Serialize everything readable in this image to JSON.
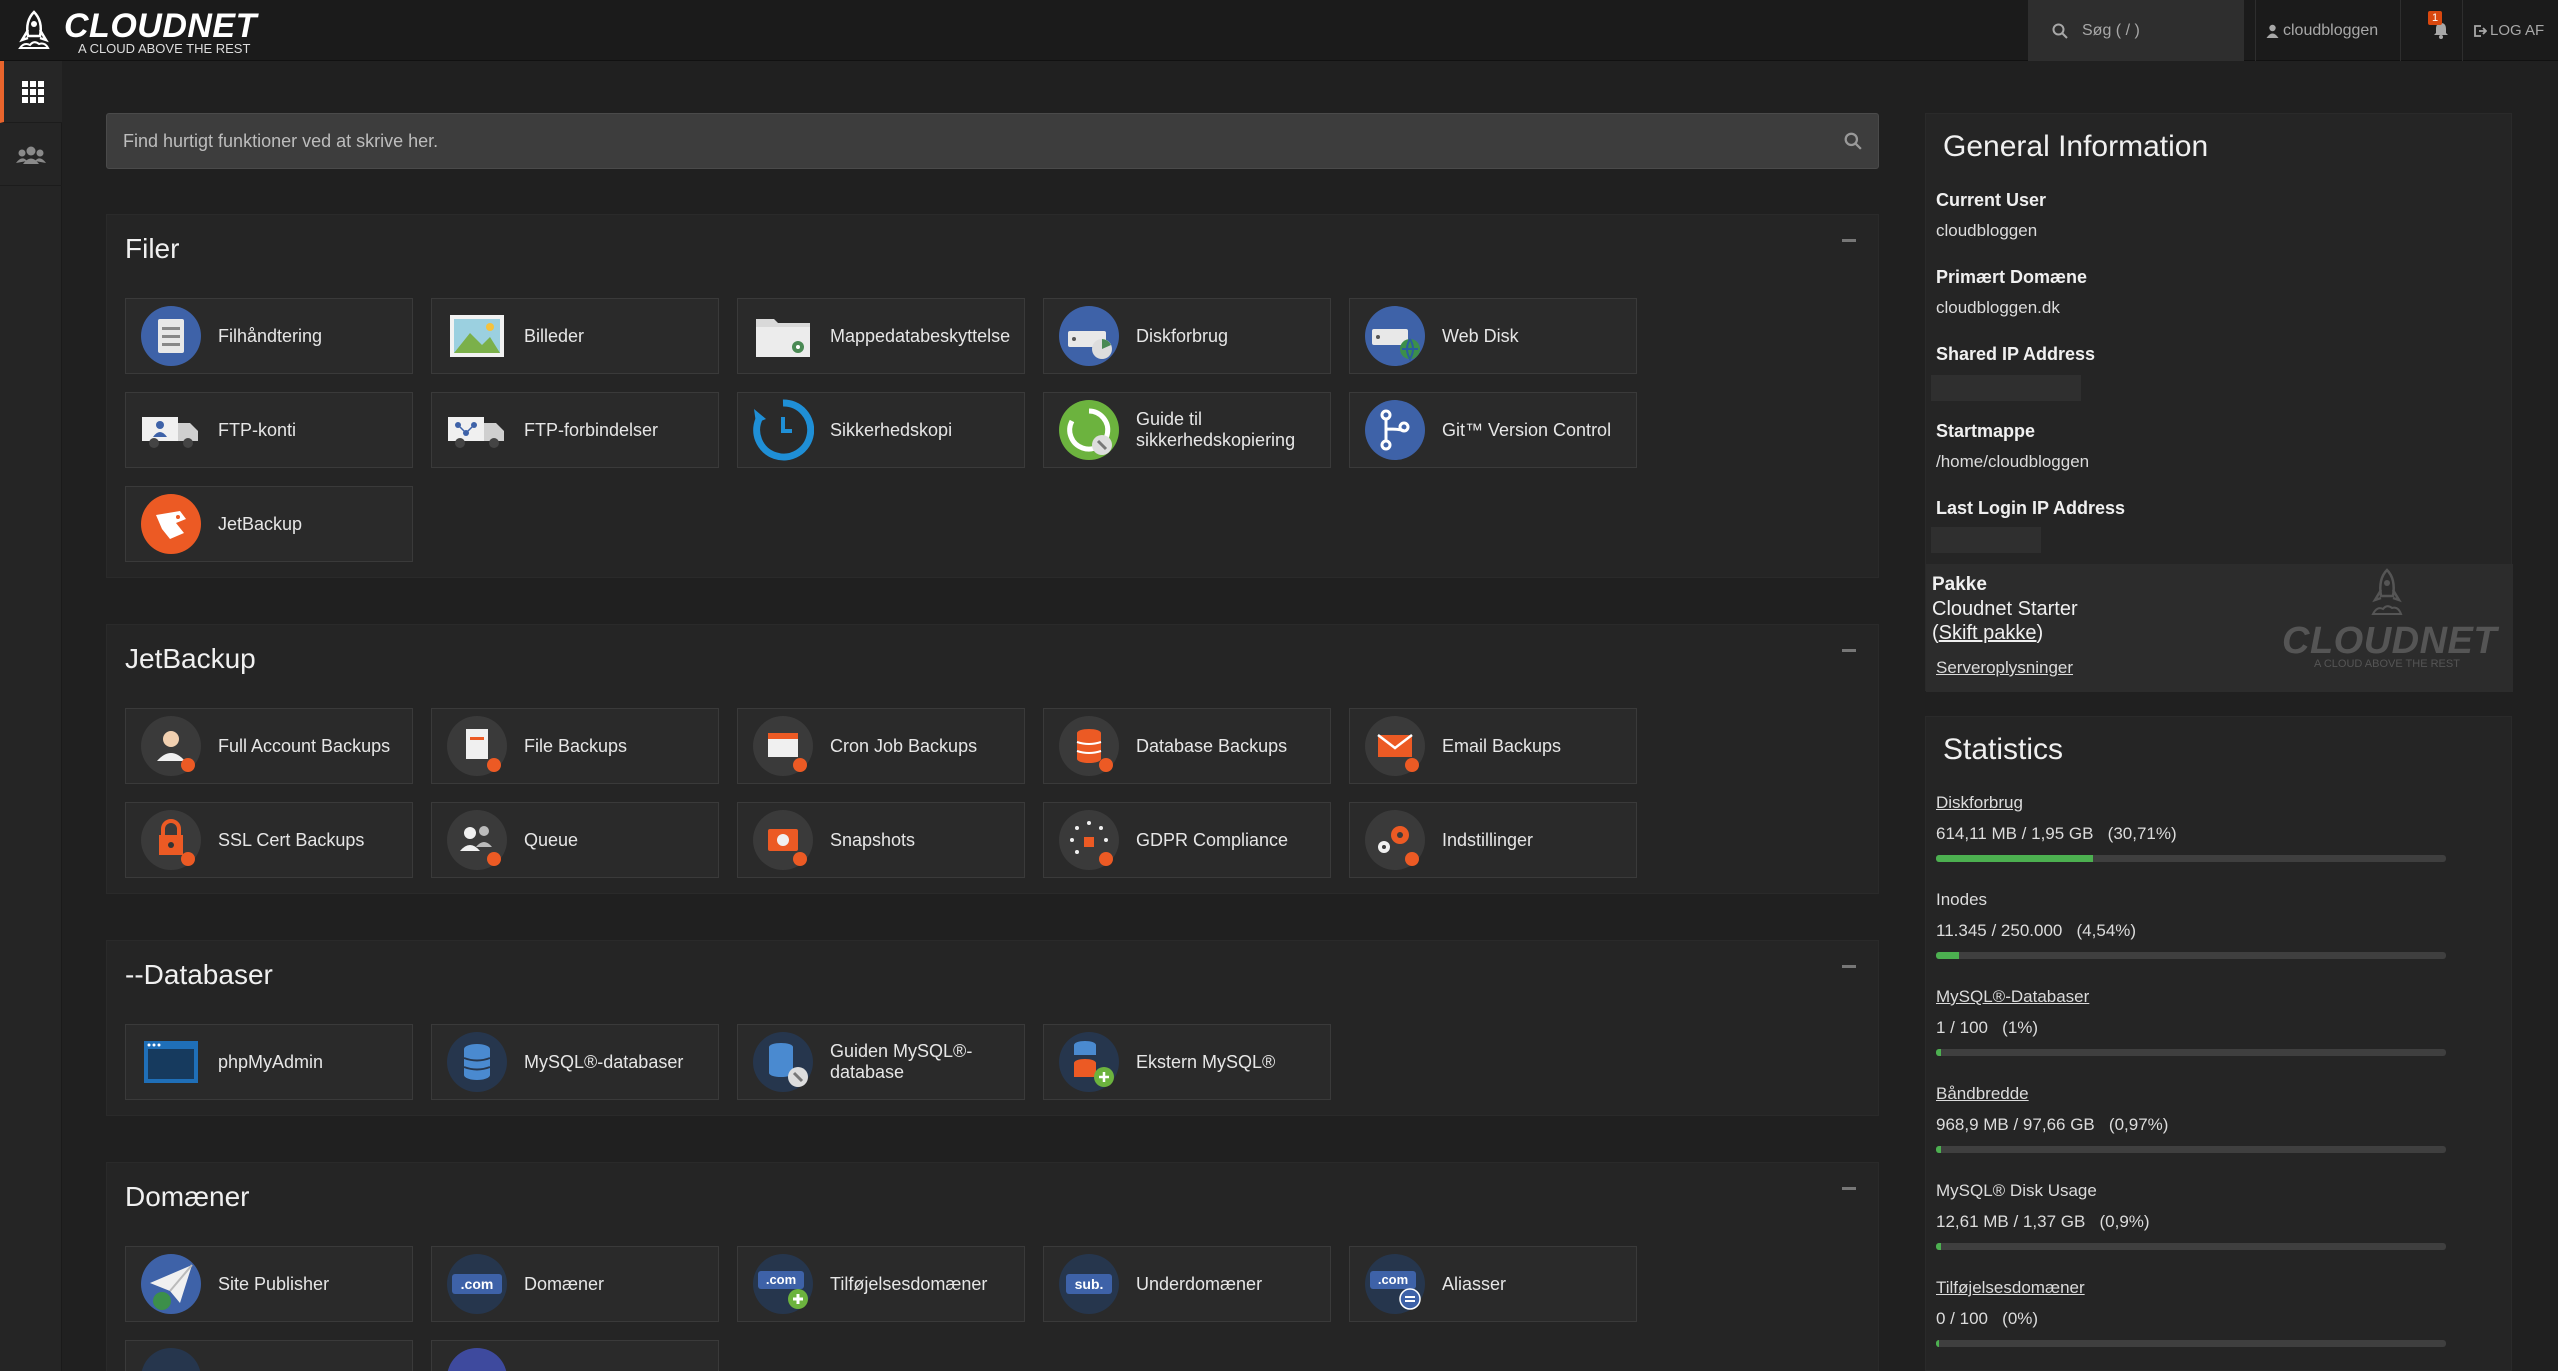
{
  "header": {
    "brand": "CLOUDNET",
    "tagline": "A CLOUD ABOVE THE REST",
    "search_label": "Søg ( / )",
    "user": "cloudbloggen",
    "notifications": "1",
    "logout": "LOG AF"
  },
  "quickfind": {
    "placeholder": "Find hurtigt funktioner ved at skrive her."
  },
  "sections": {
    "filer": {
      "title": "Filer",
      "items": [
        "Filhåndtering",
        "Billeder",
        "Mappedatabeskyttelse",
        "Diskforbrug",
        "Web Disk",
        "FTP-konti",
        "FTP-forbindelser",
        "Sikkerhedskopi",
        "Guide til sikkerhedskopiering",
        "Git™ Version Control",
        "JetBackup"
      ]
    },
    "jetbackup": {
      "title": "JetBackup",
      "items": [
        "Full Account Backups",
        "File Backups",
        "Cron Job Backups",
        "Database Backups",
        "Email Backups",
        "SSL Cert Backups",
        "Queue",
        "Snapshots",
        "GDPR Compliance",
        "Indstillinger"
      ]
    },
    "databaser": {
      "title": "--Databaser",
      "items": [
        "phpMyAdmin",
        "MySQL®-databaser",
        "Guiden MySQL®-database",
        "Ekstern MySQL®"
      ]
    },
    "domaener": {
      "title": "Domæner",
      "items": [
        "Site Publisher",
        "Domæner",
        "Tilføjelsesdomæner",
        "Underdomæner",
        "Aliasser"
      ]
    }
  },
  "general_info": {
    "title": "General Information",
    "current_user_label": "Current User",
    "current_user": "cloudbloggen",
    "primary_domain_label": "Primært Domæne",
    "primary_domain": "cloudbloggen.dk",
    "shared_ip_label": "Shared IP Address",
    "home_dir_label": "Startmappe",
    "home_dir": "/home/cloudbloggen",
    "last_login_label": "Last Login IP Address",
    "package_label": "Pakke",
    "package": "Cloudnet Starter",
    "change_package": "Skift pakke",
    "server_info": "Serveroplysninger"
  },
  "statistics": {
    "title": "Statistics",
    "items": [
      {
        "label": "Diskforbrug",
        "value": "614,11 MB / 1,95 GB   (30,71%)",
        "percent": 30.71,
        "link": true
      },
      {
        "label": "Inodes",
        "value": "11.345 / 250.000   (4,54%)",
        "percent": 4.54,
        "link": false
      },
      {
        "label": "MySQL®-Databaser",
        "value": "1 / 100   (1%)",
        "percent": 1,
        "link": true
      },
      {
        "label": "Båndbredde",
        "value": "968,9 MB / 97,66 GB   (0,97%)",
        "percent": 0.97,
        "link": true
      },
      {
        "label": "MySQL® Disk Usage",
        "value": "12,61 MB / 1,37 GB   (0,9%)",
        "percent": 0.9,
        "link": false
      },
      {
        "label": "Tilføjelsesdomæner",
        "value": "0 / 100   (0%)",
        "percent": 0,
        "link": true
      }
    ]
  },
  "colors": {
    "accent": "#e8642c",
    "progress": "#4cb050",
    "background": "#202020",
    "panel": "#252525"
  }
}
